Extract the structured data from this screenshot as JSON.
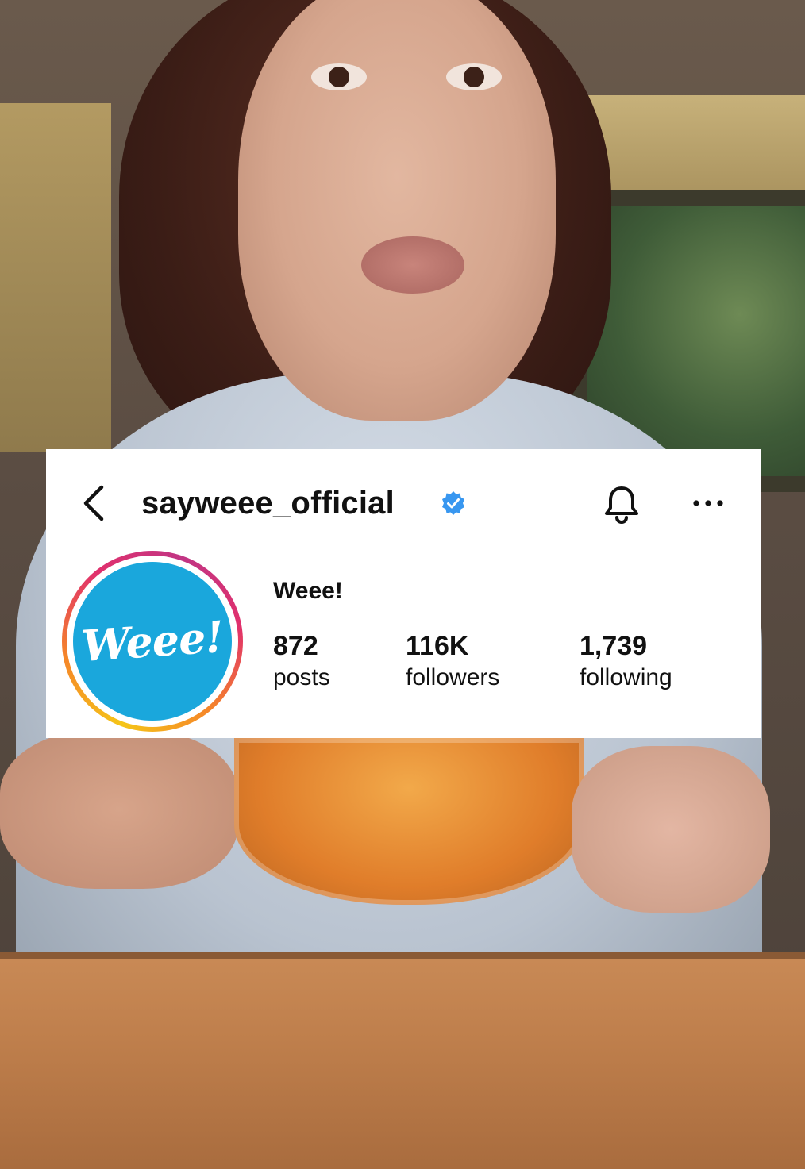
{
  "profile": {
    "username": "sayweee_official",
    "display_name": "Weee!",
    "avatar_text": "Weee!",
    "verified": true,
    "stats": {
      "posts": {
        "value": "872",
        "label": "posts"
      },
      "followers": {
        "value": "116K",
        "label": "followers"
      },
      "following": {
        "value": "1,739",
        "label": "following"
      }
    }
  },
  "icons": {
    "back": "chevron-left-icon",
    "verified": "verified-badge-icon",
    "notifications": "bell-icon",
    "more": "more-horizontal-icon"
  },
  "colors": {
    "verified_blue": "#3897f0",
    "avatar_bg": "#1aa7dc",
    "ring_gradient": [
      "#f5c518",
      "#f58529",
      "#e1306c",
      "#c13584"
    ]
  }
}
